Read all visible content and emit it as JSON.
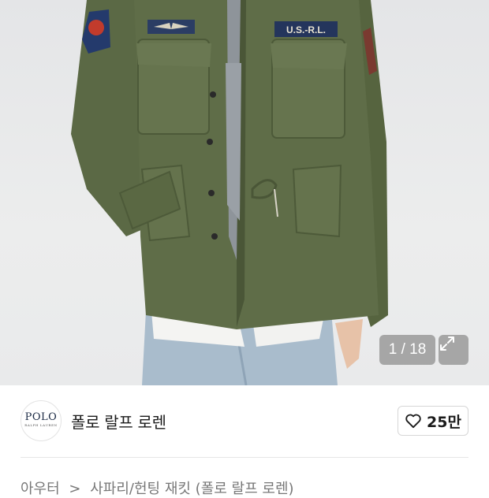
{
  "image": {
    "patch_right_text": "U.S.-R.L.",
    "page_current": "1",
    "page_total": "18",
    "page_label": "1 / 18"
  },
  "seller": {
    "logo_text": "POLO",
    "logo_subtext": "RALPH LAUREN",
    "brand_name": "폴로 랄프 로렌",
    "like_count": "25만"
  },
  "breadcrumb": {
    "category": "아우터",
    "separator": ">",
    "item": "사파리/헌팅 재킷 (폴로 랄프 로렌)"
  },
  "colors": {
    "jacket": "#5d6b47",
    "background": "#e9eaeb",
    "overlay": "rgba(110,110,110,0.55)"
  }
}
